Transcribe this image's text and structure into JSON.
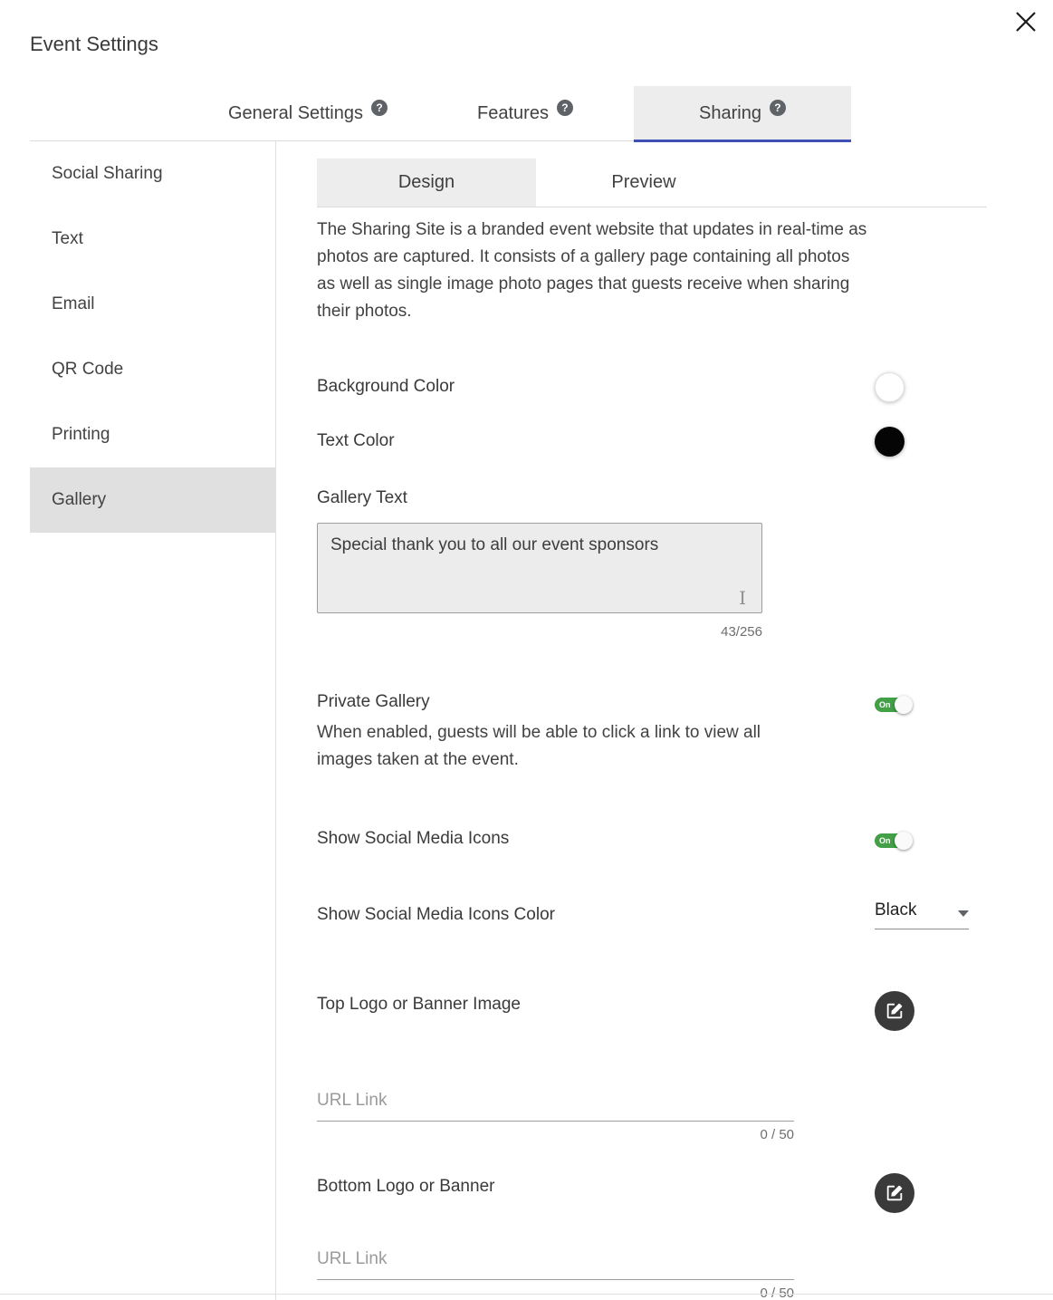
{
  "dialog": {
    "title": "Event Settings"
  },
  "tabs": [
    {
      "label": "General Settings"
    },
    {
      "label": "Features"
    },
    {
      "label": "Sharing"
    }
  ],
  "sidebar": [
    {
      "label": "Social Sharing"
    },
    {
      "label": "Text"
    },
    {
      "label": "Email"
    },
    {
      "label": "QR Code"
    },
    {
      "label": "Printing"
    },
    {
      "label": "Gallery"
    }
  ],
  "subtabs": [
    {
      "label": "Design"
    },
    {
      "label": "Preview"
    }
  ],
  "design": {
    "intro": "The Sharing Site is a branded event website that updates in real-time as photos are captured. It consists of a gallery page containing all photos as well as single image photo pages that guests receive when sharing their photos.",
    "background_color_label": "Background Color",
    "text_color_label": "Text Color",
    "gallery_text_label": "Gallery Text",
    "gallery_text_value": "Special thank you to all our event sponsors",
    "gallery_text_count": "43/256",
    "private_gallery_label": "Private Gallery",
    "private_gallery_desc": "When enabled, guests will be able to click a link to view all images taken at the event.",
    "private_gallery_state": "On",
    "social_icons_label": "Show Social Media Icons",
    "social_icons_state": "On",
    "social_icons_color_label": "Show Social Media Icons Color",
    "social_icons_color_value": "Black",
    "top_logo_label": "Top Logo or Banner Image",
    "bottom_logo_label": "Bottom Logo or Banner",
    "url_placeholder": "URL Link",
    "top_url_count": "0 / 50",
    "bottom_url_count": "0 / 50",
    "help_glyph": "?"
  },
  "colors": {
    "toggle_on": "#43a047",
    "active_tab_underline": "#3f51b5",
    "background_swatch": "#ffffff",
    "text_swatch": "#000000"
  }
}
